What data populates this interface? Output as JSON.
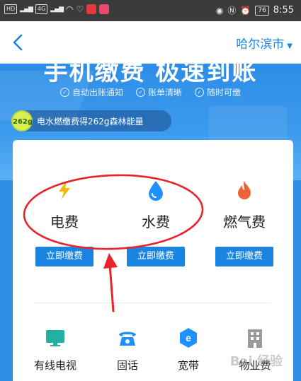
{
  "status_bar": {
    "sim1": "HD",
    "sim2": "4G",
    "battery": "76",
    "time": "8:55"
  },
  "nav": {
    "city": "哈尔滨市"
  },
  "banner": {
    "title": "手机缴费 极速到账",
    "perks": [
      "自动出账通知",
      "账单清晰",
      "随时可缴"
    ],
    "energy_badge": "262g",
    "energy_text": "电水燃缴费得262g森林能量"
  },
  "fees": [
    {
      "label": "电费",
      "button": "立即缴费"
    },
    {
      "label": "水费",
      "button": "立即缴费"
    },
    {
      "label": "燃气费",
      "button": "立即缴费"
    }
  ],
  "services": [
    {
      "label": "有线电视"
    },
    {
      "label": "固话"
    },
    {
      "label": "宽带"
    },
    {
      "label": "物业费"
    }
  ],
  "colors": {
    "accent": "#1a84e3",
    "electric": "#f5b80b",
    "water": "#1e90ff",
    "gas": "#f0633a",
    "tv": "#22b0a0",
    "annotation": "#e8232a"
  },
  "watermark": "Bai 经验"
}
